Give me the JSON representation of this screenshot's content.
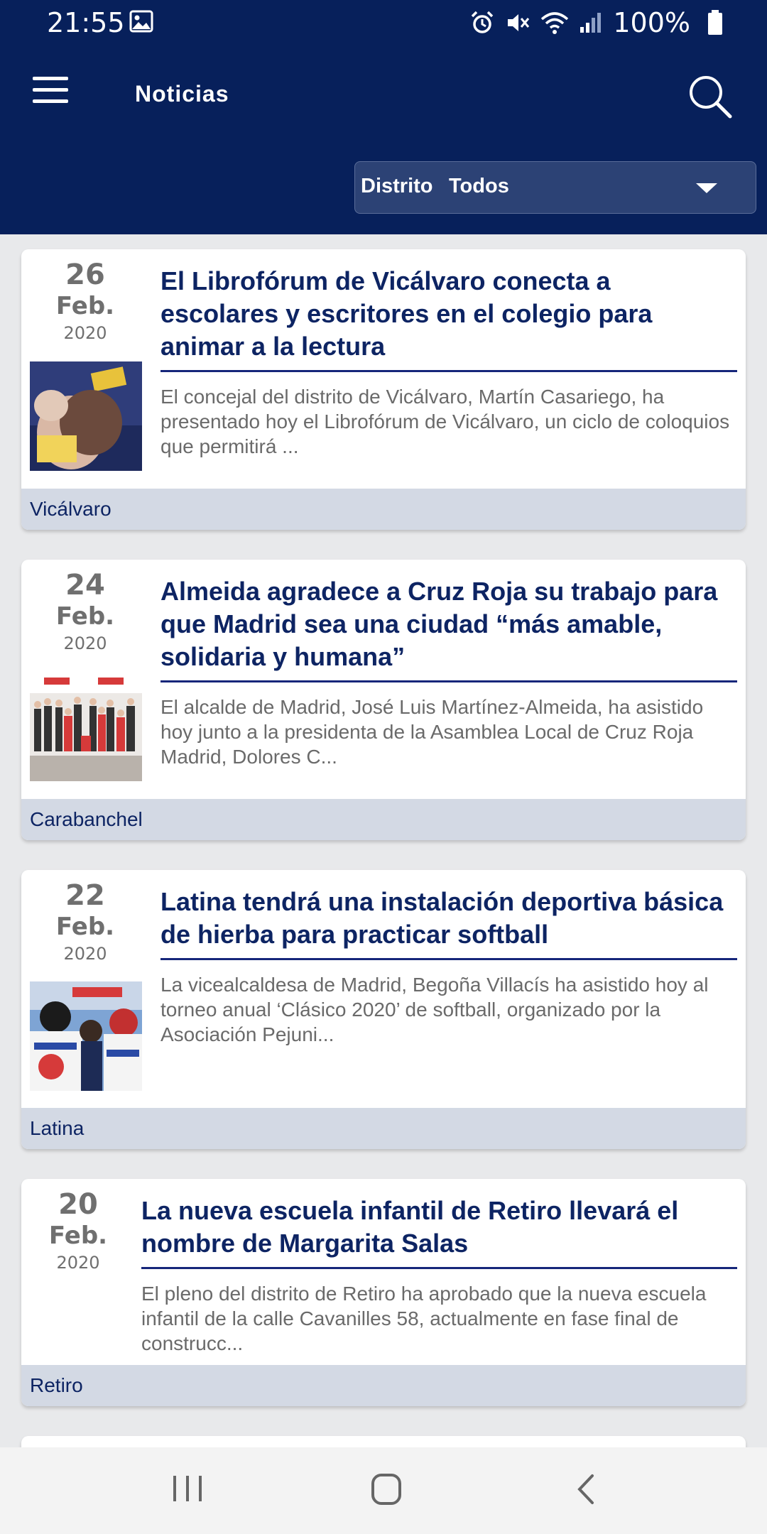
{
  "status_bar": {
    "time": "21:55",
    "battery": "100%",
    "icons": [
      "image-icon",
      "alarm-icon",
      "mute-icon",
      "wifi-icon",
      "signal-icon",
      "battery-icon"
    ]
  },
  "app_bar": {
    "title": "Noticias",
    "menu_icon": "hamburger-menu-icon",
    "search_icon": "search-icon"
  },
  "filter": {
    "label": "Distrito",
    "value": "Todos",
    "dropdown_icon": "caret-down-icon"
  },
  "news": [
    {
      "day": "26",
      "month": "Feb.",
      "year": "2020",
      "title": "El Librofórum de Vicálvaro conecta a escolares y escritores en el colegio para animar a la lectura",
      "summary": "El concejal del distrito de Vicálvaro, Martín Casariego, ha presentado hoy el Librofórum de Vicálvaro, un ciclo de coloquios que permitirá ...",
      "district": "Vicálvaro"
    },
    {
      "day": "24",
      "month": "Feb.",
      "year": "2020",
      "title": "Almeida agradece a Cruz Roja su trabajo para que Madrid sea una ciudad “más amable, solidaria y humana”",
      "summary": "El alcalde de Madrid, José Luis Martínez-Almeida, ha asistido hoy junto a la presidenta de la Asamblea Local de Cruz Roja Madrid, Dolores C...",
      "district": "Carabanchel"
    },
    {
      "day": "22",
      "month": "Feb.",
      "year": "2020",
      "title": "Latina tendrá una instalación deportiva básica de hierba para practicar softball",
      "summary": "La vicealcaldesa de Madrid, Begoña Villacís ha asistido hoy al torneo anual ‘Clásico 2020’ de softball, organizado por la Asociación Pejuni...",
      "district": "Latina"
    },
    {
      "day": "20",
      "month": "Feb.",
      "year": "2020",
      "title": "La nueva escuela infantil de Retiro llevará el nombre de Margarita Salas",
      "summary": "El pleno del distrito de Retiro ha aprobado que la nueva escuela infantil de la calle Cavanilles 58, actualmente en fase final de construcc...",
      "district": "Retiro"
    }
  ],
  "nav_bar": {
    "icons": [
      "recent-apps-icon",
      "home-icon",
      "back-icon"
    ]
  },
  "colors": {
    "header_bg": "#07205b",
    "title_text": "#0d2463",
    "district_bar": "#d3d9e4",
    "page_bg": "#e8e9eb"
  }
}
